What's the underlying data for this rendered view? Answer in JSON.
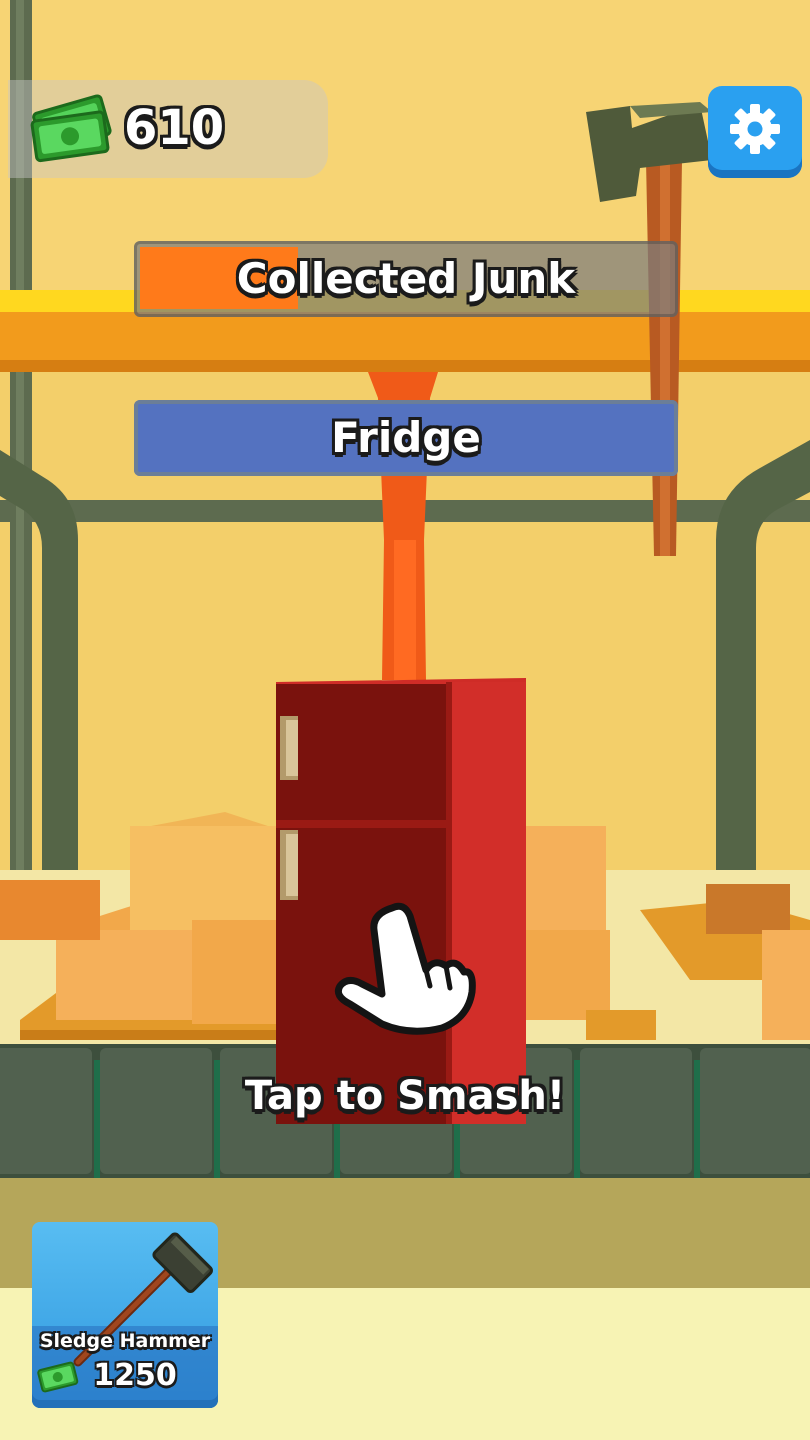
{
  "hud": {
    "money": "610",
    "money_icon": "cash-icon",
    "settings_icon": "gear-icon"
  },
  "progress": {
    "label": "Collected Junk",
    "fill_fraction": 0.29,
    "fill_color": "#ff7a1a"
  },
  "current_item": {
    "label": "Fridge",
    "color": "#5472c0"
  },
  "hint": {
    "text": "Tap to Smash!",
    "icon": "pointing-hand-icon"
  },
  "shop": {
    "tool_name": "Sledge Hammer",
    "price": "1250",
    "tool_icon": "sledge-hammer-icon",
    "price_icon": "cash-icon"
  }
}
